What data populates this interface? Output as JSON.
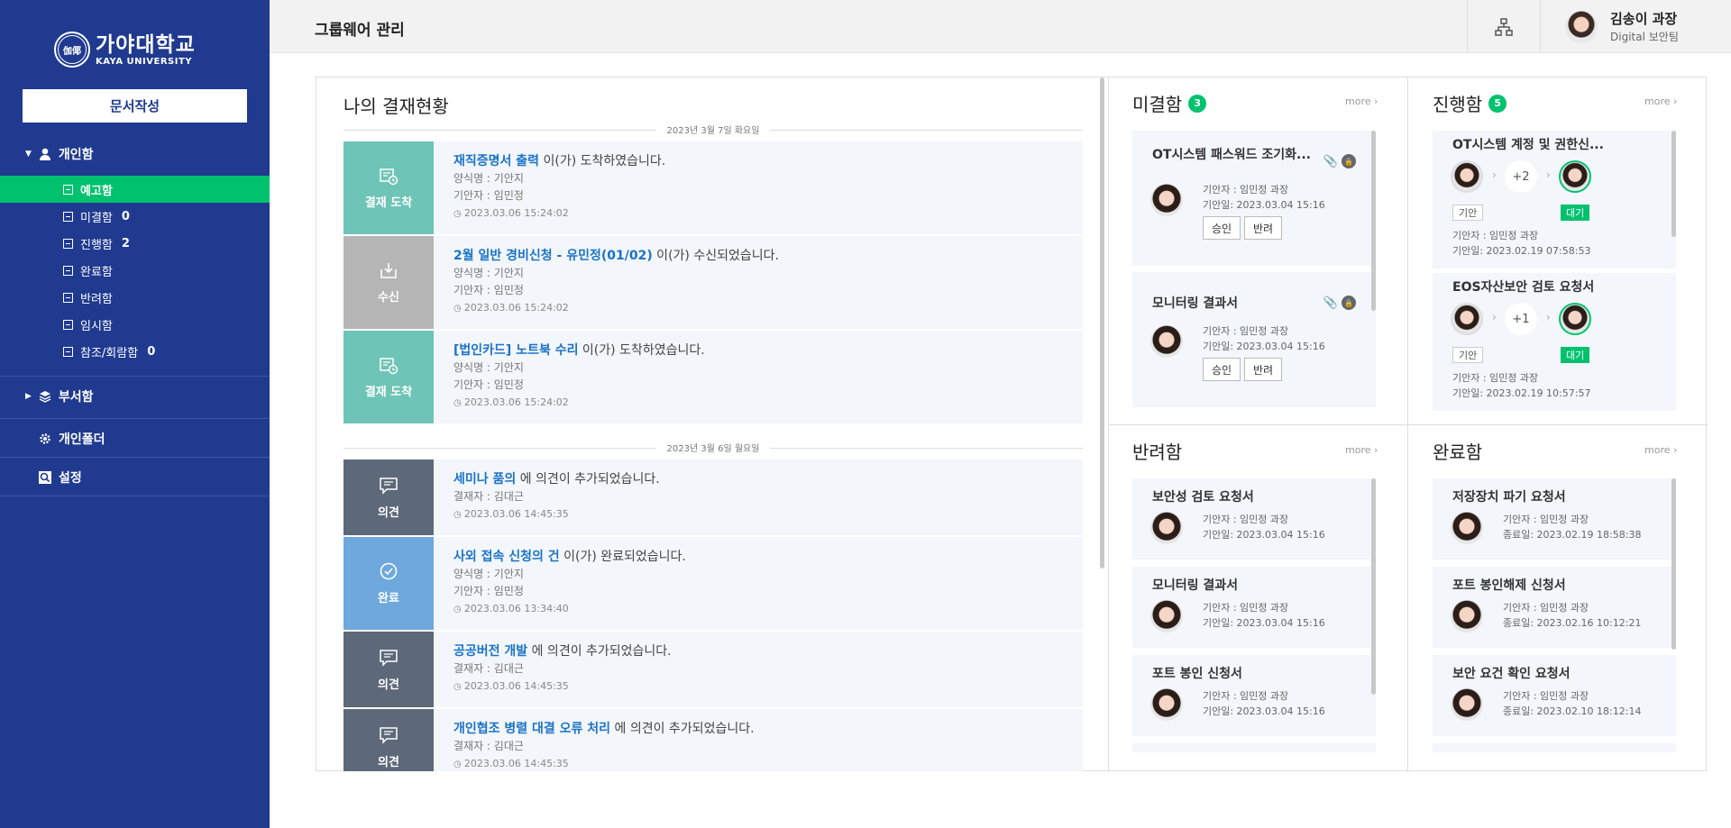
{
  "sidebar": {
    "logo": {
      "korean": "가야대학교",
      "english": "KAYA UNIVERSITY"
    },
    "write_button": "문서작성",
    "personal_section": "개인함",
    "items": [
      {
        "label": "예고함",
        "count": ""
      },
      {
        "label": "미결함",
        "count": "0"
      },
      {
        "label": "진행함",
        "count": "2"
      },
      {
        "label": "완료함",
        "count": ""
      },
      {
        "label": "반려함",
        "count": ""
      },
      {
        "label": "임시함",
        "count": ""
      },
      {
        "label": "참조/회람함",
        "count": "0"
      }
    ],
    "dept_section": "부서함",
    "folder_section": "개인폴더",
    "settings_section": "설정"
  },
  "topbar": {
    "title": "그룹웨어 관리",
    "user_name": "김송이 과장",
    "user_dept": "Digital 보안팀"
  },
  "my_status": {
    "title": "나의 결재현황",
    "date1": "2023년 3월 7일 화요일",
    "date2": "2023년 3월 6일 월요일",
    "rows": [
      {
        "tag": "결재 도착",
        "link": "재직증명서 출력",
        "msg": " 이(가) 도착하였습니다.",
        "line1": "양식명 : 기안지",
        "line2": "기안자 : 임민정",
        "time": "2023.03.06 15:24:02"
      },
      {
        "tag": "수신",
        "link": "2월 일반 경비신청 - 유민정(01/02)",
        "msg": " 이(가) 수신되었습니다.",
        "line1": "양식명 : 기안지",
        "line2": "기안자 : 임민정",
        "time": "2023.03.06 15:24:02"
      },
      {
        "tag": "결재 도착",
        "link": "[법인카드] 노트북 수리",
        "msg": " 이(가) 도착하였습니다.",
        "line1": "양식명 : 기안지",
        "line2": "기안자 : 임민정",
        "time": "2023.03.06 15:24:02"
      },
      {
        "tag": "의견",
        "link": "세미나 품의",
        "msg": " 에 의견이 추가되었습니다.",
        "line1": "결재자 : 김대근",
        "time": "2023.03.06 14:45:35"
      },
      {
        "tag": "완료",
        "link": "사외 접속 신청의 건",
        "msg": " 이(가) 완료되었습니다.",
        "line1": "양식명 : 기안지",
        "line2": "기안자 : 임민정",
        "time": "2023.03.06 13:34:40"
      },
      {
        "tag": "의견",
        "link": "공공버전 개발",
        "msg": " 에 의견이 추가되었습니다.",
        "line1": "결재자 : 김대근",
        "time": "2023.03.06 14:45:35"
      },
      {
        "tag": "의견",
        "link": "개인협조 병렬 대결 오류 처리",
        "msg": " 에 의견이 추가되었습니다.",
        "line1": "결재자 : 김대근",
        "time": "2023.03.06 14:45:35"
      }
    ]
  },
  "pending": {
    "title": "미결함",
    "count": "3",
    "more": "more",
    "cards": [
      {
        "title": "OT시스템 패스워드 조기화...",
        "drafter": "기안자 : 임민정 과장",
        "date": "기안일: 2023.03.04 15:16",
        "approve": "승인",
        "reject": "반려"
      },
      {
        "title": "모니터링 결과서",
        "drafter": "기안자 : 임민정 과장",
        "date": "기안일: 2023.03.04 15:16",
        "approve": "승인",
        "reject": "반려"
      }
    ]
  },
  "progress": {
    "title": "진행함",
    "count": "5",
    "more": "more",
    "cards": [
      {
        "title": "OT시스템 계정 및 권한신...",
        "plus": "+2",
        "tag1": "기안",
        "tag2": "대기",
        "drafter": "기안자 : 임민정 과장",
        "date": "기안일: 2023.02.19 07:58:53"
      },
      {
        "title": "EOS자산보안 검토 요청서",
        "plus": "+1",
        "tag1": "기안",
        "tag2": "대기",
        "drafter": "기안자 : 임민정 과장",
        "date": "기안일: 2023.02.19 10:57:57"
      }
    ]
  },
  "rejected": {
    "title": "반려함",
    "more": "more",
    "cards": [
      {
        "title": "보안성 검토 요청서",
        "drafter": "기안자 : 임민정 과장",
        "date": "기안일: 2023.03.04 15:16"
      },
      {
        "title": "모니터링 결과서",
        "drafter": "기안자 : 임민정 과장",
        "date": "기안일: 2023.03.04 15:16"
      },
      {
        "title": "포트 봉인 신청서",
        "drafter": "기안자 : 임민정 과장",
        "date": "기안일: 2023.03.04 15:16"
      }
    ]
  },
  "completed": {
    "title": "완료함",
    "more": "more",
    "cards": [
      {
        "title": "저장장치 파기 요청서",
        "drafter": "기안자 : 임민정 과장",
        "date": "종료일: 2023.02.19 18:58:38"
      },
      {
        "title": "포트 봉인해제 신청서",
        "drafter": "기안자 : 임민정 과장",
        "date": "종료일: 2023.02.16 10:12:21"
      },
      {
        "title": "보안 요건 확인 요청서",
        "drafter": "기안자 : 임민정 과장",
        "date": "종료일: 2023.02.10 18:12:14"
      }
    ]
  },
  "colors": {
    "sidebar": "#1f3a8f",
    "accent": "#00c26e",
    "link": "#1a73c8"
  },
  "icons": [
    "university-seal",
    "user-icon",
    "layers-icon",
    "gear-icon",
    "search-icon",
    "org-chart-icon",
    "approval-icon",
    "receive-icon",
    "comment-icon",
    "check-icon",
    "clip-icon",
    "lock-icon",
    "chevron-right-icon"
  ]
}
